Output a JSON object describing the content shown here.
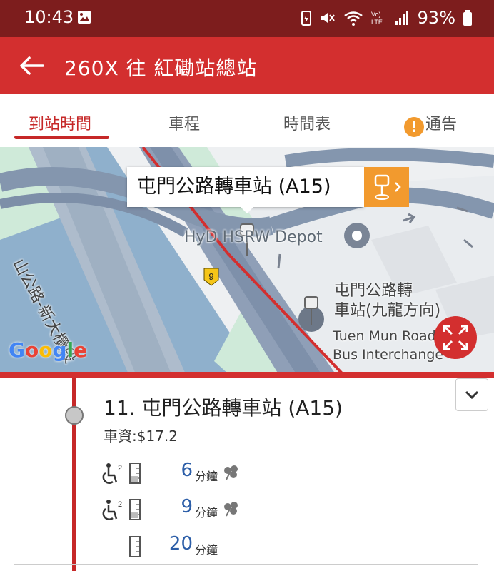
{
  "status_bar": {
    "time": "10:43",
    "battery": "93%",
    "icons": [
      "gallery-icon",
      "data-saver-icon",
      "mute-icon",
      "wifi-icon",
      "volte-icon",
      "signal-icon",
      "battery-icon"
    ]
  },
  "app_bar": {
    "title": "260X 往 紅磡站總站",
    "back_icon": "arrow-left-icon"
  },
  "tabs": [
    {
      "label": "到站時間",
      "active": true
    },
    {
      "label": "車程",
      "active": false
    },
    {
      "label": "時間表",
      "active": false
    },
    {
      "label": "通告",
      "active": false,
      "icon": "alert-icon"
    }
  ],
  "map": {
    "callout_title": "屯門公路轉車站 (A15)",
    "road_label": "山公路-新大欖段",
    "poi_label": "HyD HSRW Depot",
    "route_shield": "9",
    "station_label_zh_1": "屯門公路轉",
    "station_label_zh_2": "車站(九龍方向)",
    "station_label_en_1": "Tuen Mun Road",
    "station_label_en_2": "Bus Interchange",
    "logo": "Google"
  },
  "stop": {
    "name": "11. 屯門公路轉車站 (A15)",
    "fare": "車資:$17.2"
  },
  "etas": [
    {
      "minutes": "6",
      "unit": "分鐘",
      "wheelchair": true,
      "wheelchair_sup": "2",
      "occupancy": 0.33,
      "scheduled_icon": true
    },
    {
      "minutes": "9",
      "unit": "分鐘",
      "wheelchair": true,
      "wheelchair_sup": "2",
      "occupancy": 0.33,
      "scheduled_icon": true
    },
    {
      "minutes": "20",
      "unit": "分鐘",
      "wheelchair": false,
      "occupancy": 0,
      "scheduled_icon": false
    }
  ],
  "colors": {
    "status_bar": "#7d1d1d",
    "app_bar": "#d32f2f",
    "accent": "#c62828",
    "eta_number": "#2c5ea8",
    "callout_button": "#f29a2e"
  }
}
